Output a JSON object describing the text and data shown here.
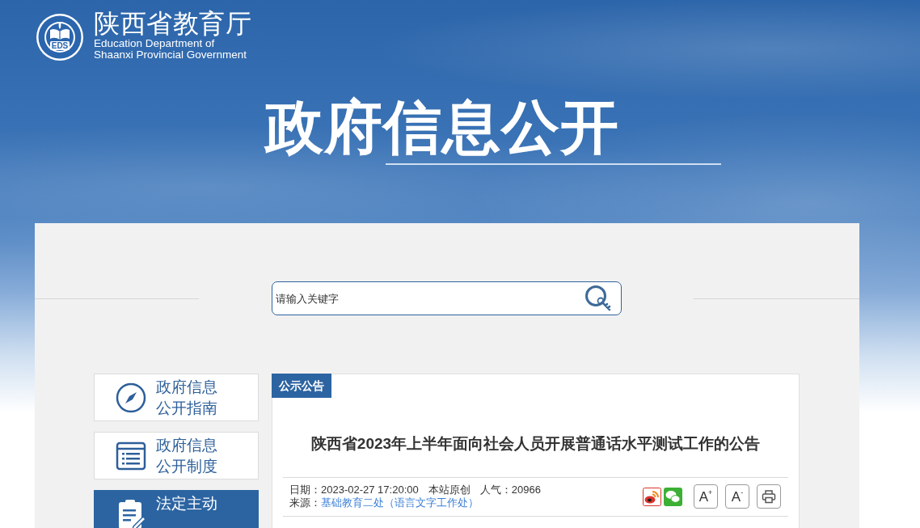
{
  "header": {
    "site_title": "陕西省教育厅",
    "site_subtitle_lines": [
      "Education Department of",
      "Shaanxi Provincial Government"
    ],
    "logo_text": "EDS",
    "banner_title": "政府信息公开"
  },
  "search": {
    "placeholder": "请输入关键字"
  },
  "sidebar": {
    "items": [
      {
        "label": "政府信息公开指南",
        "selected": false
      },
      {
        "label": "政府信息公开制度",
        "selected": false
      },
      {
        "label": "法定主动",
        "selected": true
      }
    ]
  },
  "article": {
    "category": "公示公告",
    "title": "陕西省2023年上半年面向社会人员开展普通话水平测试工作的公告",
    "meta": {
      "date": "日期：2023-02-27 17:20:00",
      "origin": "本站原创",
      "views": "人气：20966",
      "source_label": "来源：",
      "source_link": "基础教育二处（语言文字工作处）"
    },
    "font_buttons": [
      "A$^{+}$",
      "A$^{-}$"
    ]
  }
}
